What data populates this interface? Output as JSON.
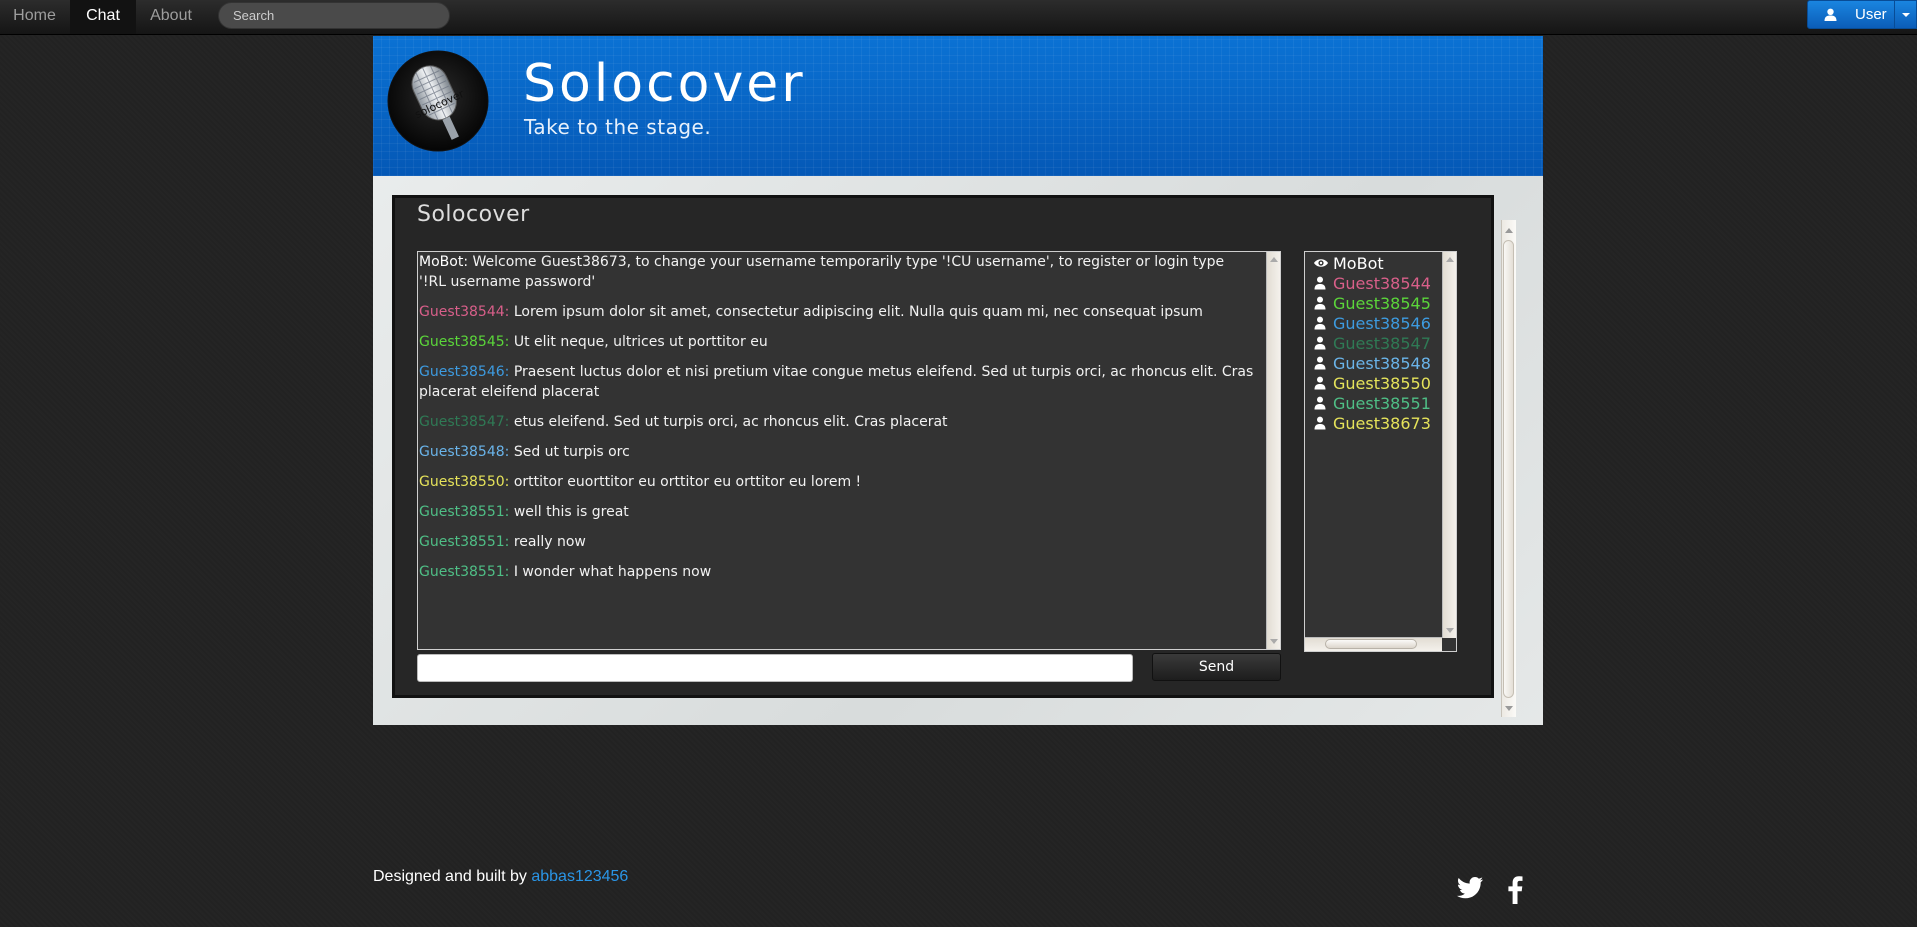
{
  "nav": {
    "items": [
      {
        "label": "Home",
        "active": false
      },
      {
        "label": "Chat",
        "active": true
      },
      {
        "label": "About",
        "active": false
      }
    ],
    "search_placeholder": "Search",
    "user_label": "User"
  },
  "header": {
    "logo_text": "solocover",
    "title": "Solocover",
    "tagline": "Take to the stage."
  },
  "chat": {
    "title": "Solocover",
    "messages": [
      {
        "user": "MoBot",
        "text": "Welcome Guest38673, to change your username temporarily type '!CU username', to register or login type '!RL username password'",
        "color": "#ffffff"
      },
      {
        "user": "Guest38544",
        "text": "Lorem ipsum dolor sit amet, consectetur adipiscing elit. Nulla quis quam mi, nec consequat ipsum",
        "color": "#d95f8a"
      },
      {
        "user": "Guest38545",
        "text": "Ut elit neque, ultrices ut porttitor eu",
        "color": "#5bd63a"
      },
      {
        "user": "Guest38546",
        "text": "Praesent luctus dolor et nisi pretium vitae congue metus eleifend. Sed ut turpis orci, ac rhoncus elit. Cras placerat eleifend placerat",
        "color": "#3d9be0"
      },
      {
        "user": "Guest38547",
        "text": "etus eleifend. Sed ut turpis orci, ac rhoncus elit. Cras placerat",
        "color": "#2f7a55"
      },
      {
        "user": "Guest38548",
        "text": "Sed ut turpis orc",
        "color": "#6ab4ea"
      },
      {
        "user": "Guest38550",
        "text": "orttitor euorttitor eu orttitor eu orttitor eu lorem !",
        "color": "#e6e35a"
      },
      {
        "user": "Guest38551",
        "text": "well this is great",
        "color": "#4fbf86"
      },
      {
        "user": "Guest38551",
        "text": "really now",
        "color": "#4fbf86"
      },
      {
        "user": "Guest38551",
        "text": "I wonder what happens now",
        "color": "#4fbf86"
      }
    ],
    "input_value": "",
    "send_label": "Send"
  },
  "users": [
    {
      "name": "MoBot",
      "icon": "eye-icon",
      "color": "#ffffff"
    },
    {
      "name": "Guest38544",
      "icon": "user-icon",
      "color": "#d95f8a"
    },
    {
      "name": "Guest38545",
      "icon": "user-icon",
      "color": "#5bd63a"
    },
    {
      "name": "Guest38546",
      "icon": "user-icon",
      "color": "#3d9be0"
    },
    {
      "name": "Guest38547",
      "icon": "user-icon",
      "color": "#2f7a55"
    },
    {
      "name": "Guest38548",
      "icon": "user-icon",
      "color": "#6ab4ea"
    },
    {
      "name": "Guest38550",
      "icon": "user-icon",
      "color": "#e6e35a"
    },
    {
      "name": "Guest38551",
      "icon": "user-icon",
      "color": "#4fbf86"
    },
    {
      "name": "Guest38673",
      "icon": "user-icon",
      "color": "#e6e35a"
    }
  ],
  "footer": {
    "text": "Designed and built by",
    "author": "abbas123456",
    "social": [
      "twitter-icon",
      "facebook-icon"
    ]
  }
}
